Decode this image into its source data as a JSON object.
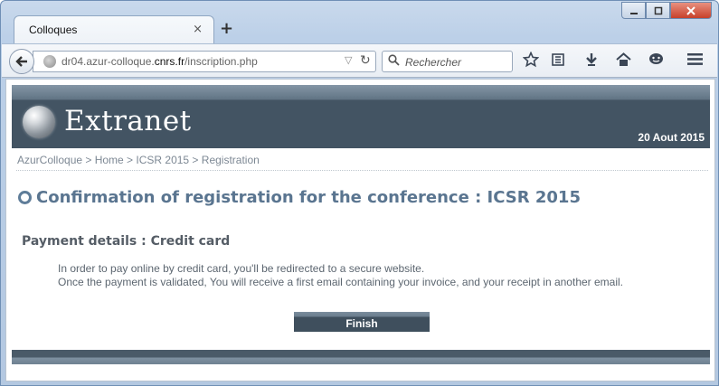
{
  "browser": {
    "tab_title": "Colloques",
    "tab_close_glyph": "×",
    "new_tab_glyph": "+",
    "url_prefix": "dr04.azur-colloque.",
    "url_domain": "cnrs.fr",
    "url_suffix": "/inscription.php",
    "search_placeholder": "Rechercher",
    "icons": [
      "back-icon",
      "globe-icon",
      "dropdown-icon",
      "reload-icon",
      "search-icon",
      "bookmark-star-icon",
      "reading-list-icon",
      "download-icon",
      "home-icon",
      "chat-icon",
      "menu-icon",
      "minimize-icon",
      "maximize-icon",
      "close-icon"
    ]
  },
  "header": {
    "logo_text": "Extranet",
    "date": "20 Aout 2015"
  },
  "breadcrumb": "AzurColloque > Home > ICSR 2015 > Registration",
  "main": {
    "heading": "Confirmation of registration for the conference : ICSR 2015",
    "payment_title": "Payment details : Credit card",
    "payment_line1": "In order to pay online by credit card, you'll be redirected to a secure website.",
    "payment_line2": "Once the payment is validated, You will receive a first email containing your invoice, and your receipt in another email.",
    "finish_label": "Finish"
  },
  "colors": {
    "banner": "#435463",
    "heading": "#5a7590",
    "button": "#3f4f5d"
  }
}
